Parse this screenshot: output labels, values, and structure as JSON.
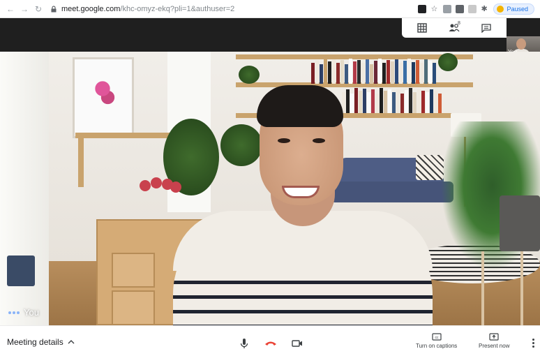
{
  "browser": {
    "url_host": "meet.google.com",
    "url_path": "/khc-omyz-ekq?pli=1&authuser=2",
    "profile_status": "Paused"
  },
  "video": {
    "participant_label": "You",
    "self_view_label": "You"
  },
  "bottom_bar": {
    "meeting_details_label": "Meeting details",
    "captions_label": "Turn on captions",
    "present_label": "Present now"
  },
  "top_controls": {
    "people_count": "8"
  },
  "colors": {
    "end_call_red": "#ea4335",
    "dark_header": "#1f1f1f",
    "accent_blue": "#1a73e8"
  }
}
